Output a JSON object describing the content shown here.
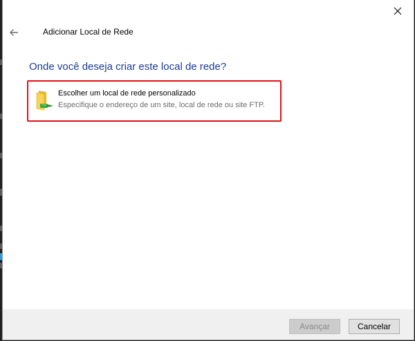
{
  "window": {
    "title": "Adicionar Local de Rede",
    "close_icon": "close-icon",
    "back_icon": "back-arrow-icon"
  },
  "main": {
    "heading": "Onde você deseja criar este local de rede?",
    "heading_color": "#1c3c8f",
    "options": [
      {
        "title": "Escolher um local de rede personalizado",
        "description": "Especifique o endereço de um site, local de rede ou site FTP.",
        "icon": "network-folder-icon",
        "highlight_color": "#e0101a"
      }
    ]
  },
  "footer": {
    "next_label": "Avançar",
    "next_enabled": false,
    "cancel_label": "Cancelar"
  }
}
